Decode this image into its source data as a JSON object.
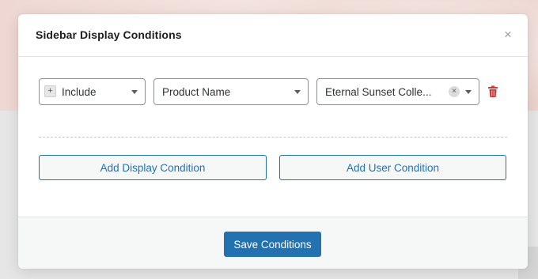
{
  "modal": {
    "title": "Sidebar Display Conditions",
    "close_icon": "×"
  },
  "condition_row": {
    "include_select": {
      "badge": "+",
      "value": "Include"
    },
    "field_select": {
      "value": "Product Name"
    },
    "value_select": {
      "value": "Eternal Sunset Colle...",
      "clear_icon": "×"
    },
    "delete_icon": "trash-icon"
  },
  "actions": {
    "add_display_condition": "Add Display Condition",
    "add_user_condition": "Add User Condition"
  },
  "footer": {
    "save_label": "Save Conditions"
  },
  "colors": {
    "primary": "#2271b1",
    "danger": "#d63638",
    "border": "#8c8f94"
  }
}
